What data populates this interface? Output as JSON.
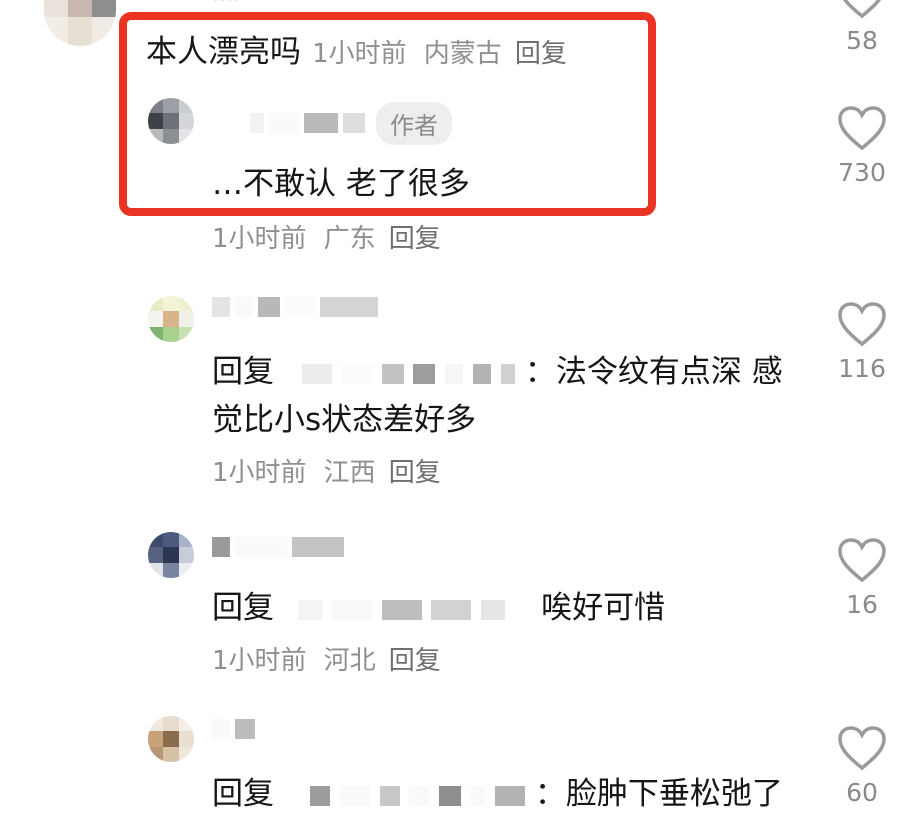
{
  "top_comment": {
    "text": "本人漂亮吗",
    "time": "1小时前",
    "location": "内蒙古",
    "reply_label": "回复",
    "likes": "58"
  },
  "author_reply": {
    "badge": "作者",
    "text": "…不敢认 老了很多",
    "time": "1小时前",
    "location": "广东",
    "reply_label": "回复",
    "likes": "730"
  },
  "replies": [
    {
      "reply_prefix": "回复",
      "text_line1": "：法令纹有点深 感",
      "text_line2": "觉比小s状态差好多",
      "time": "1小时前",
      "location": "江西",
      "reply_label": "回复",
      "likes": "116"
    },
    {
      "reply_prefix": "回复",
      "text_line1": "唉好可惜",
      "time": "1小时前",
      "location": "河北",
      "reply_label": "回复",
      "likes": "16"
    },
    {
      "reply_prefix": "回复",
      "text_line1": "：脸肿下垂松弛了",
      "likes": "60"
    }
  ],
  "colors": {
    "highlight_border": "#ea3323",
    "meta_text": "#8f8f8f"
  },
  "icons": {
    "like": "heart-outline-icon"
  }
}
